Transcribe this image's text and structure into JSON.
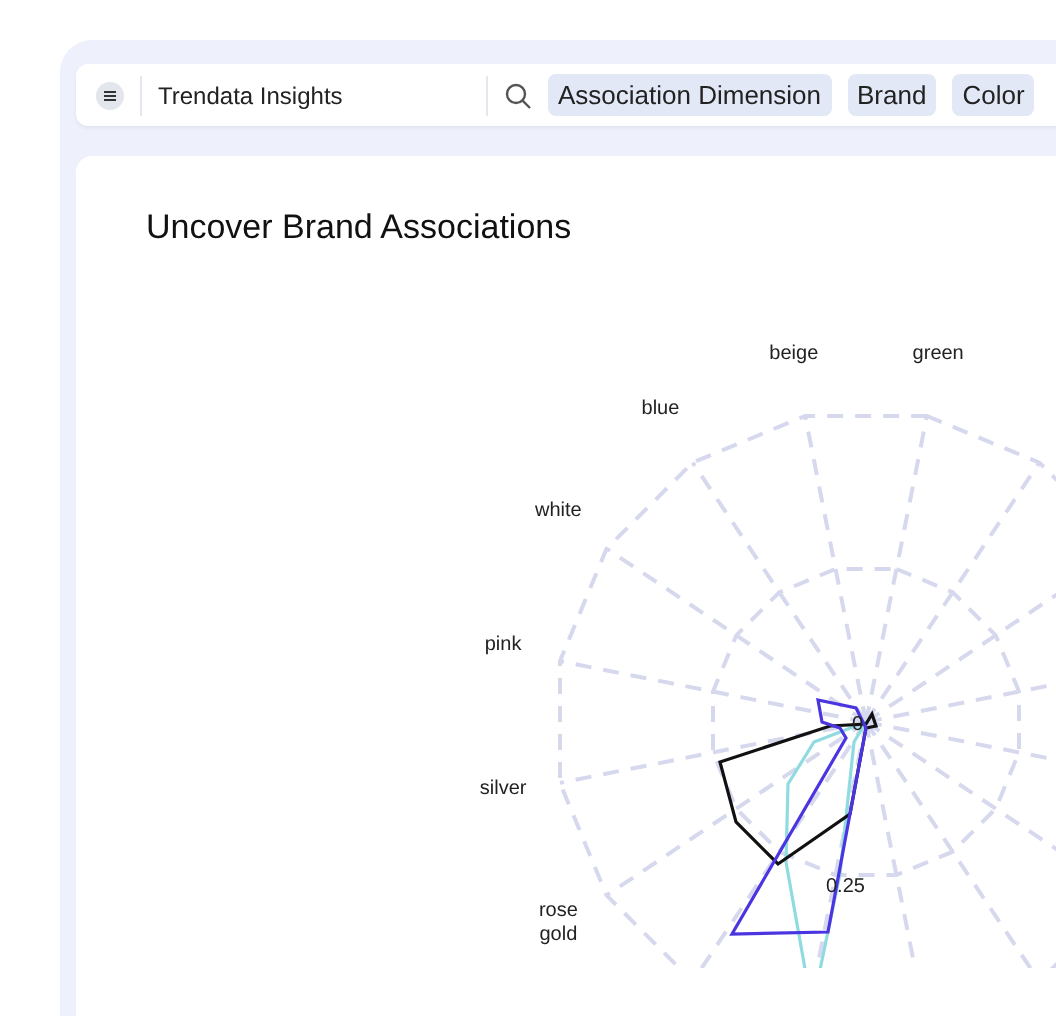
{
  "app": {
    "title": "Trendata Insights"
  },
  "filters": [
    {
      "label": "Association Dimension"
    },
    {
      "label": "Brand"
    },
    {
      "label": "Color"
    }
  ],
  "page": {
    "title": "Uncover Brand Associations"
  },
  "chart": {
    "axis_labels": [
      "beige",
      "green",
      "blue",
      "white",
      "pink",
      "silver",
      "rose gold"
    ],
    "tick_labels": [
      "0",
      "0.25"
    ]
  }
}
